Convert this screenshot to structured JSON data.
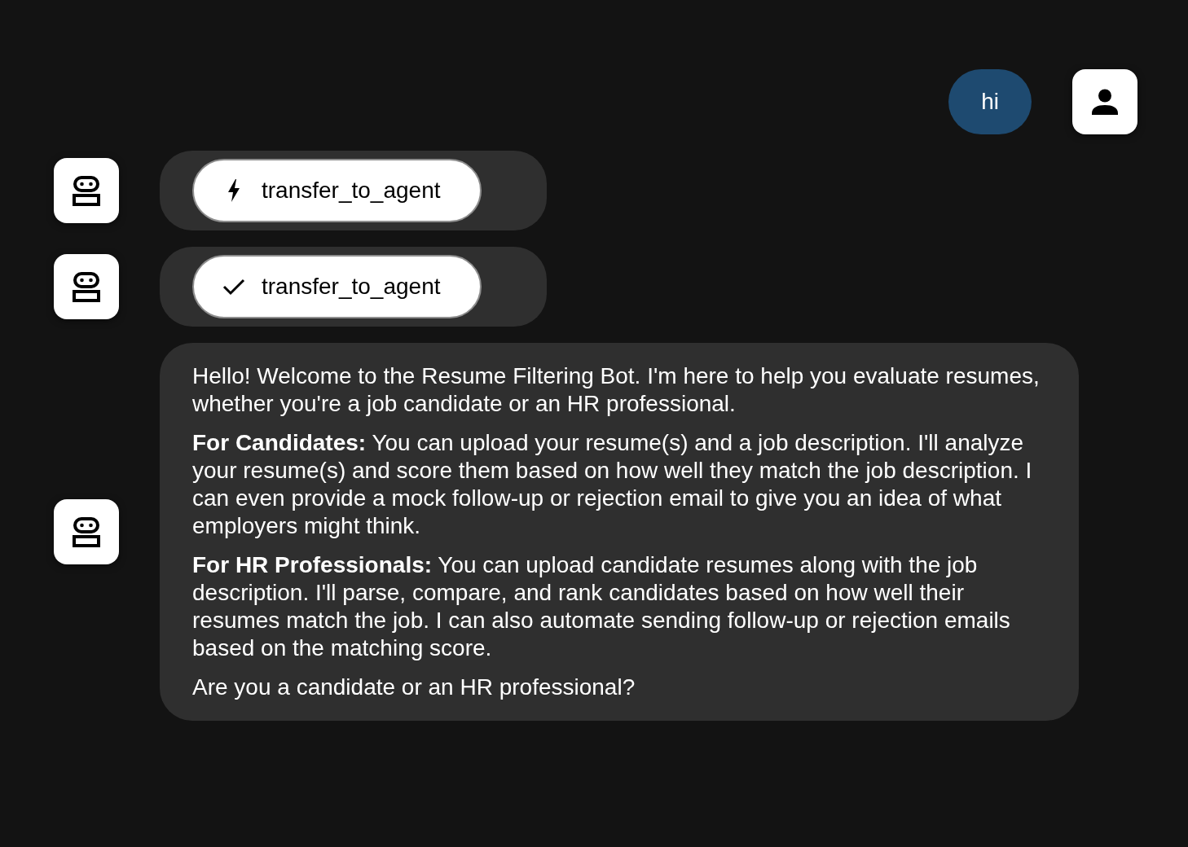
{
  "messages": [
    {
      "kind": "user_message",
      "paragraphs": [
        "hi"
      ]
    },
    {
      "kind": "tool_call",
      "name": "transfer_to_agent",
      "done": false
    },
    {
      "kind": "tool_call",
      "name": "transfer_to_agent",
      "done": true
    },
    {
      "kind": "bot_message",
      "paragraphs": [
        "Hello! Welcome to the Resume Filtering Bot. I'm here to help you evaluate resumes, whether you're a job candidate or an HR professional.",
        "**For Candidates:** You can upload your resume(s) and a job description. I'll analyze your resume(s) and score them based on how well they match the job description. I can even provide a mock follow-up or rejection email to give you an idea of what employers might think.",
        "**For HR Professionals:** You can upload candidate resumes along with the job description. I'll parse, compare, and rank candidates based on how well their resumes match the job. I can also automate sending follow-up or rejection emails based on the matching score.",
        "Are you a candidate or an HR professional?"
      ]
    }
  ]
}
